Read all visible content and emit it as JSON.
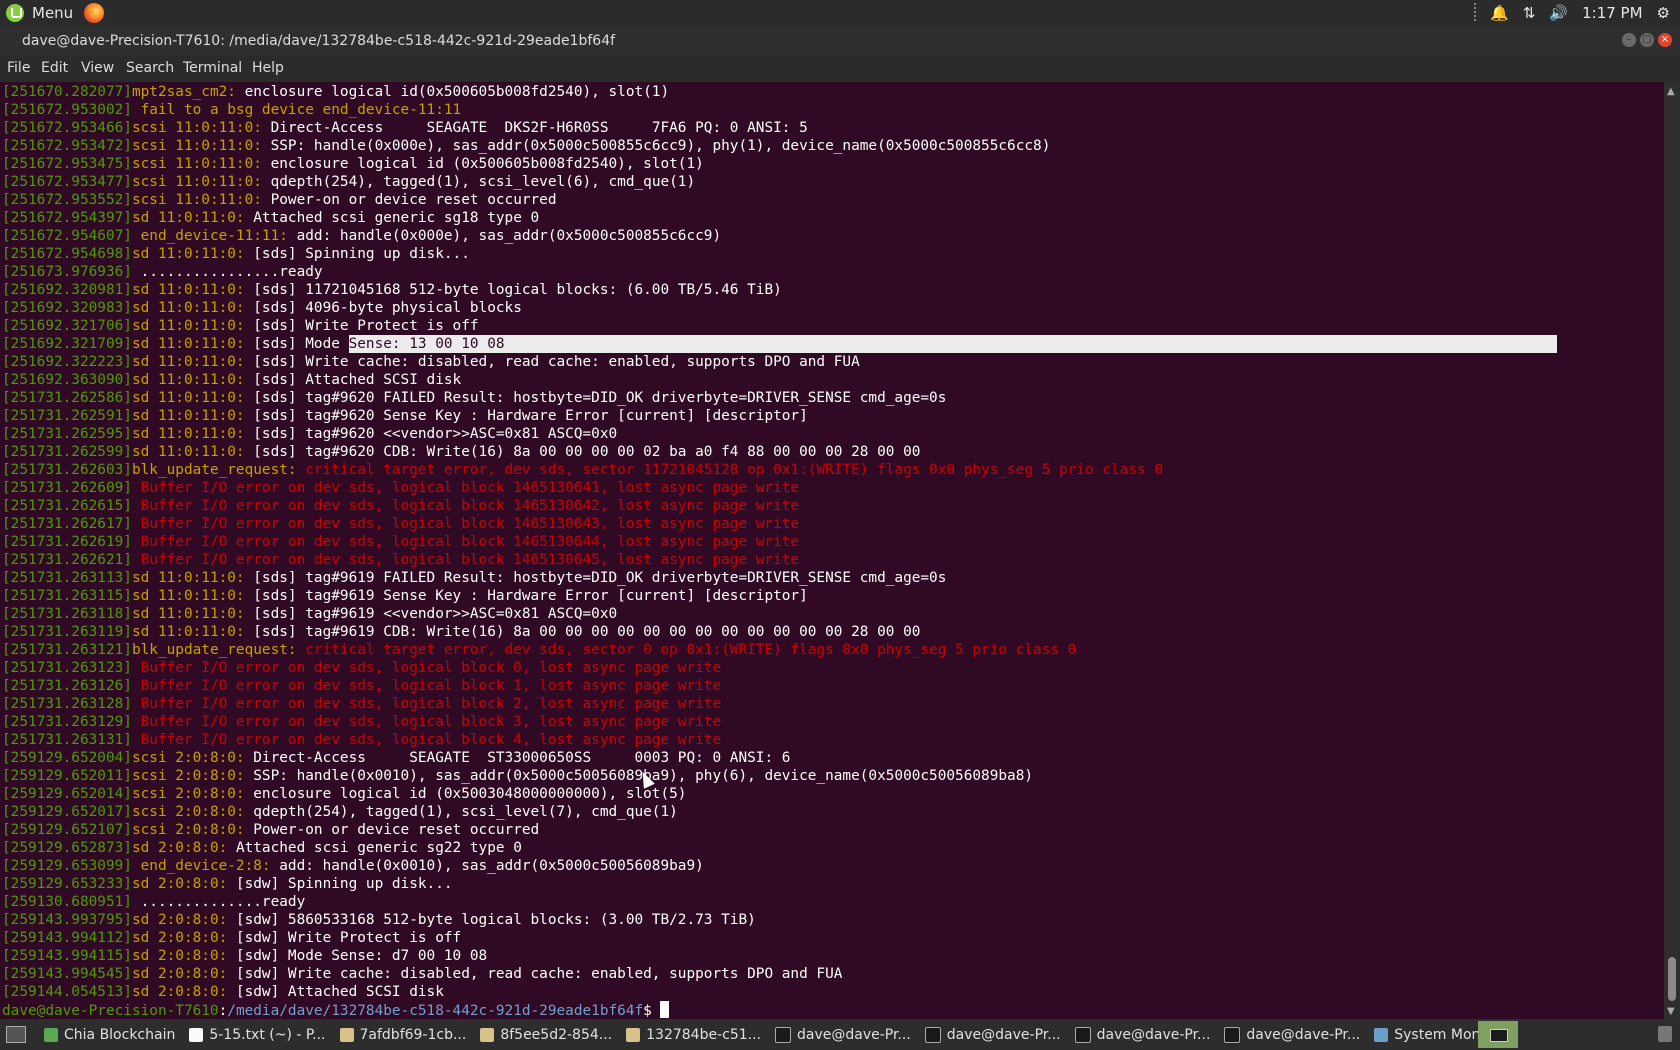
{
  "topbar": {
    "menu_label": "Menu",
    "clock": "1:17 PM"
  },
  "window": {
    "title": "dave@dave-Precision-T7610: /media/dave/132784be-c518-442c-921d-29eade1bf64f"
  },
  "menubar": [
    "File",
    "Edit",
    "View",
    "Search",
    "Terminal",
    "Help"
  ],
  "colors": {
    "background": "#300a24",
    "timestamp": "#4e9a06",
    "device": "#c4a000",
    "error": "#cc0000",
    "path": "#729fcf"
  },
  "terminal": {
    "lines": [
      {
        "t": "[251670.282077]",
        "d": "mpt2sas_cm2:",
        "m": " enclosure logical id(0x500605b008fd2540), slot(1)",
        "k": "n"
      },
      {
        "t": "[251672.953002]",
        "d": "",
        "m": " fail to a bsg device end_device-11:11",
        "k": "dev"
      },
      {
        "t": "[251672.953466]",
        "d": "scsi 11:0:11:0:",
        "m": " Direct-Access     SEAGATE  DKS2F-H6R0SS     7FA6 PQ: 0 ANSI: 5",
        "k": "n"
      },
      {
        "t": "[251672.953472]",
        "d": "scsi 11:0:11:0:",
        "m": " SSP: handle(0x000e), sas_addr(0x5000c500855c6cc9), phy(1), device_name(0x5000c500855c6cc8)",
        "k": "n"
      },
      {
        "t": "[251672.953475]",
        "d": "scsi 11:0:11:0:",
        "m": " enclosure logical id (0x500605b008fd2540), slot(1)",
        "k": "n"
      },
      {
        "t": "[251672.953477]",
        "d": "scsi 11:0:11:0:",
        "m": " qdepth(254), tagged(1), scsi_level(6), cmd_que(1)",
        "k": "n"
      },
      {
        "t": "[251672.953552]",
        "d": "scsi 11:0:11:0:",
        "m": " Power-on or device reset occurred",
        "k": "n"
      },
      {
        "t": "[251672.954397]",
        "d": "sd 11:0:11:0:",
        "m": " Attached scsi generic sg18 type 0",
        "k": "n"
      },
      {
        "t": "[251672.954607]",
        "d": " end_device-11:11:",
        "m": " add: handle(0x000e), sas_addr(0x5000c500855c6cc9)",
        "k": "n"
      },
      {
        "t": "[251672.954698]",
        "d": "sd 11:0:11:0:",
        "m": " [sds] Spinning up disk...",
        "k": "n"
      },
      {
        "t": "[251673.976936]",
        "d": "",
        "m": " ................ready",
        "k": "n"
      },
      {
        "t": "[251692.320981]",
        "d": "sd 11:0:11:0:",
        "m": " [sds] 11721045168 512-byte logical blocks: (6.00 TB/5.46 TiB)",
        "k": "n"
      },
      {
        "t": "[251692.320983]",
        "d": "sd 11:0:11:0:",
        "m": " [sds] 4096-byte physical blocks",
        "k": "n"
      },
      {
        "t": "[251692.321706]",
        "d": "sd 11:0:11:0:",
        "m": " [sds] Write Protect is off",
        "k": "n"
      },
      {
        "t": "[251692.321709]",
        "d": "sd 11:0:11:0:",
        "m": " [sds] Mode ",
        "s": "Sense: 13 00 10 08",
        "k": "sel"
      },
      {
        "t": "[251692.322223]",
        "d": "sd 11:0:11:0:",
        "m": " [sds] Write cache: disabled, read cache: enabled, supports DPO and FUA",
        "k": "n"
      },
      {
        "t": "[251692.363090]",
        "d": "sd 11:0:11:0:",
        "m": " [sds] Attached SCSI disk",
        "k": "n"
      },
      {
        "t": "[251731.262586]",
        "d": "sd 11:0:11:0:",
        "m": " [sds] tag#9620 FAILED Result: hostbyte=DID_OK driverbyte=DRIVER_SENSE cmd_age=0s",
        "k": "n"
      },
      {
        "t": "[251731.262591]",
        "d": "sd 11:0:11:0:",
        "m": " [sds] tag#9620 Sense Key : Hardware Error [current] [descriptor]",
        "k": "n"
      },
      {
        "t": "[251731.262595]",
        "d": "sd 11:0:11:0:",
        "m": " [sds] tag#9620 <<vendor>>ASC=0x81 ASCQ=0x0",
        "k": "n"
      },
      {
        "t": "[251731.262599]",
        "d": "sd 11:0:11:0:",
        "m": " [sds] tag#9620 CDB: Write(16) 8a 00 00 00 00 02 ba a0 f4 88 00 00 00 28 00 00",
        "k": "n"
      },
      {
        "t": "[251731.262603]",
        "d": "blk_update_request:",
        "m": " critical target error, dev sds, sector 11721045128 op 0x1:(WRITE) flags 0x0 phys_seg 5 prio class 0",
        "k": "err"
      },
      {
        "t": "[251731.262609]",
        "d": "",
        "m": " Buffer I/O error on dev sds, logical block 1465130641, lost async page write",
        "k": "err"
      },
      {
        "t": "[251731.262615]",
        "d": "",
        "m": " Buffer I/O error on dev sds, logical block 1465130642, lost async page write",
        "k": "err"
      },
      {
        "t": "[251731.262617]",
        "d": "",
        "m": " Buffer I/O error on dev sds, logical block 1465130643, lost async page write",
        "k": "err"
      },
      {
        "t": "[251731.262619]",
        "d": "",
        "m": " Buffer I/O error on dev sds, logical block 1465130644, lost async page write",
        "k": "err"
      },
      {
        "t": "[251731.262621]",
        "d": "",
        "m": " Buffer I/O error on dev sds, logical block 1465130645, lost async page write",
        "k": "err"
      },
      {
        "t": "[251731.263113]",
        "d": "sd 11:0:11:0:",
        "m": " [sds] tag#9619 FAILED Result: hostbyte=DID_OK driverbyte=DRIVER_SENSE cmd_age=0s",
        "k": "n"
      },
      {
        "t": "[251731.263115]",
        "d": "sd 11:0:11:0:",
        "m": " [sds] tag#9619 Sense Key : Hardware Error [current] [descriptor]",
        "k": "n"
      },
      {
        "t": "[251731.263118]",
        "d": "sd 11:0:11:0:",
        "m": " [sds] tag#9619 <<vendor>>ASC=0x81 ASCQ=0x0",
        "k": "n"
      },
      {
        "t": "[251731.263119]",
        "d": "sd 11:0:11:0:",
        "m": " [sds] tag#9619 CDB: Write(16) 8a 00 00 00 00 00 00 00 00 00 00 00 00 28 00 00",
        "k": "n"
      },
      {
        "t": "[251731.263121]",
        "d": "blk_update_request:",
        "m": " critical target error, dev sds, sector 0 op 0x1:(WRITE) flags 0x0 phys_seg 5 prio class 0",
        "k": "err"
      },
      {
        "t": "[251731.263123]",
        "d": "",
        "m": " Buffer I/O error on dev sds, logical block 0, lost async page write",
        "k": "err"
      },
      {
        "t": "[251731.263126]",
        "d": "",
        "m": " Buffer I/O error on dev sds, logical block 1, lost async page write",
        "k": "err"
      },
      {
        "t": "[251731.263128]",
        "d": "",
        "m": " Buffer I/O error on dev sds, logical block 2, lost async page write",
        "k": "err"
      },
      {
        "t": "[251731.263129]",
        "d": "",
        "m": " Buffer I/O error on dev sds, logical block 3, lost async page write",
        "k": "err"
      },
      {
        "t": "[251731.263131]",
        "d": "",
        "m": " Buffer I/O error on dev sds, logical block 4, lost async page write",
        "k": "err"
      },
      {
        "t": "[259129.652004]",
        "d": "scsi 2:0:8:0:",
        "m": " Direct-Access     SEAGATE  ST33000650SS     0003 PQ: 0 ANSI: 6",
        "k": "n"
      },
      {
        "t": "[259129.652011]",
        "d": "scsi 2:0:8:0:",
        "m": " SSP: handle(0x0010), sas_addr(0x5000c50056089ba9), phy(6), device_name(0x5000c50056089ba8)",
        "k": "n"
      },
      {
        "t": "[259129.652014]",
        "d": "scsi 2:0:8:0:",
        "m": " enclosure logical id (0x5003048000000000), slot(5)",
        "k": "n"
      },
      {
        "t": "[259129.652017]",
        "d": "scsi 2:0:8:0:",
        "m": " qdepth(254), tagged(1), scsi_level(7), cmd_que(1)",
        "k": "n"
      },
      {
        "t": "[259129.652107]",
        "d": "scsi 2:0:8:0:",
        "m": " Power-on or device reset occurred",
        "k": "n"
      },
      {
        "t": "[259129.652873]",
        "d": "sd 2:0:8:0:",
        "m": " Attached scsi generic sg22 type 0",
        "k": "n"
      },
      {
        "t": "[259129.653099]",
        "d": " end_device-2:8:",
        "m": " add: handle(0x0010), sas_addr(0x5000c50056089ba9)",
        "k": "n"
      },
      {
        "t": "[259129.653233]",
        "d": "sd 2:0:8:0:",
        "m": " [sdw] Spinning up disk...",
        "k": "n"
      },
      {
        "t": "[259130.680951]",
        "d": "",
        "m": " ..............ready",
        "k": "n"
      },
      {
        "t": "[259143.993795]",
        "d": "sd 2:0:8:0:",
        "m": " [sdw] 5860533168 512-byte logical blocks: (3.00 TB/2.73 TiB)",
        "k": "n"
      },
      {
        "t": "[259143.994112]",
        "d": "sd 2:0:8:0:",
        "m": " [sdw] Write Protect is off",
        "k": "n"
      },
      {
        "t": "[259143.994115]",
        "d": "sd 2:0:8:0:",
        "m": " [sdw] Mode Sense: d7 00 10 08",
        "k": "n"
      },
      {
        "t": "[259143.994545]",
        "d": "sd 2:0:8:0:",
        "m": " [sdw] Write cache: disabled, read cache: enabled, supports DPO and FUA",
        "k": "n"
      },
      {
        "t": "[259144.054513]",
        "d": "sd 2:0:8:0:",
        "m": " [sdw] Attached SCSI disk",
        "k": "n"
      }
    ],
    "prompt": {
      "user_host": "dave@dave-Precision-T7610",
      "sep": ":",
      "path": "/media/dave/132784be-c518-442c-921d-29eade1bf64f",
      "symbol": "$ "
    }
  },
  "taskbar": {
    "items": [
      {
        "label": "Chia Blockchain",
        "icon": "chia-icon"
      },
      {
        "label": "5-15.txt (~) - P...",
        "icon": "text-editor-icon"
      },
      {
        "label": "7afdbf69-1cb...",
        "icon": "folder-icon"
      },
      {
        "label": "8f5ee5d2-854...",
        "icon": "folder-icon"
      },
      {
        "label": "132784be-c51...",
        "icon": "folder-icon"
      },
      {
        "label": "dave@dave-Pr...",
        "icon": "terminal-icon"
      },
      {
        "label": "dave@dave-Pr...",
        "icon": "terminal-icon"
      },
      {
        "label": "dave@dave-Pr...",
        "icon": "terminal-icon"
      },
      {
        "label": "dave@dave-Pr...",
        "icon": "terminal-icon"
      },
      {
        "label": "System Monitor",
        "icon": "system-monitor-icon"
      }
    ]
  }
}
